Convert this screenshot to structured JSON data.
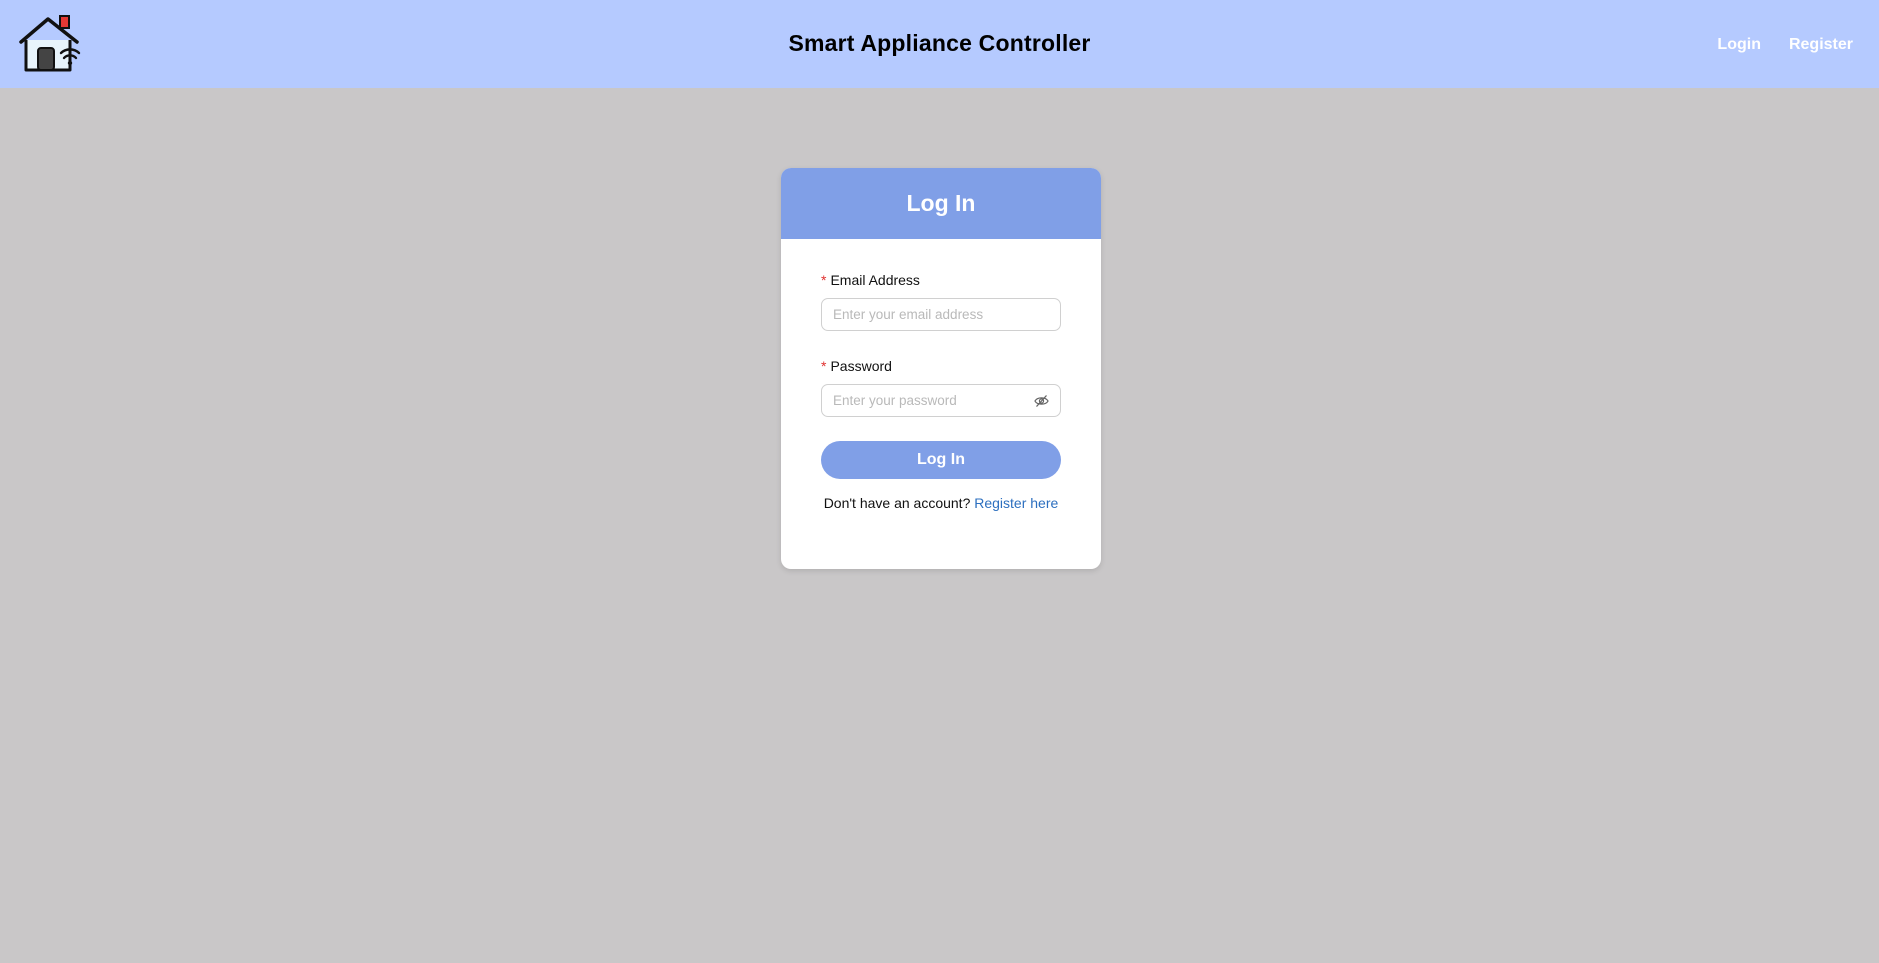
{
  "header": {
    "app_title": "Smart Appliance Controller",
    "logo_icon": "smart-home-icon",
    "nav": {
      "login_label": "Login",
      "register_label": "Register"
    }
  },
  "login_card": {
    "title": "Log In",
    "email": {
      "required_mark": "*",
      "label": "Email Address",
      "placeholder": "Enter your email address",
      "value": ""
    },
    "password": {
      "required_mark": "*",
      "label": "Password",
      "placeholder": "Enter your password",
      "value": "",
      "toggle_icon": "eye-slash-icon"
    },
    "submit_label": "Log In",
    "register_prompt": "Don't have an account?",
    "register_link": "Register here"
  },
  "colors": {
    "navbar_bg": "#b5caff",
    "page_bg": "#c9c7c8",
    "accent": "#809fe7",
    "link": "#2c6fbf",
    "required": "#e0312f"
  }
}
